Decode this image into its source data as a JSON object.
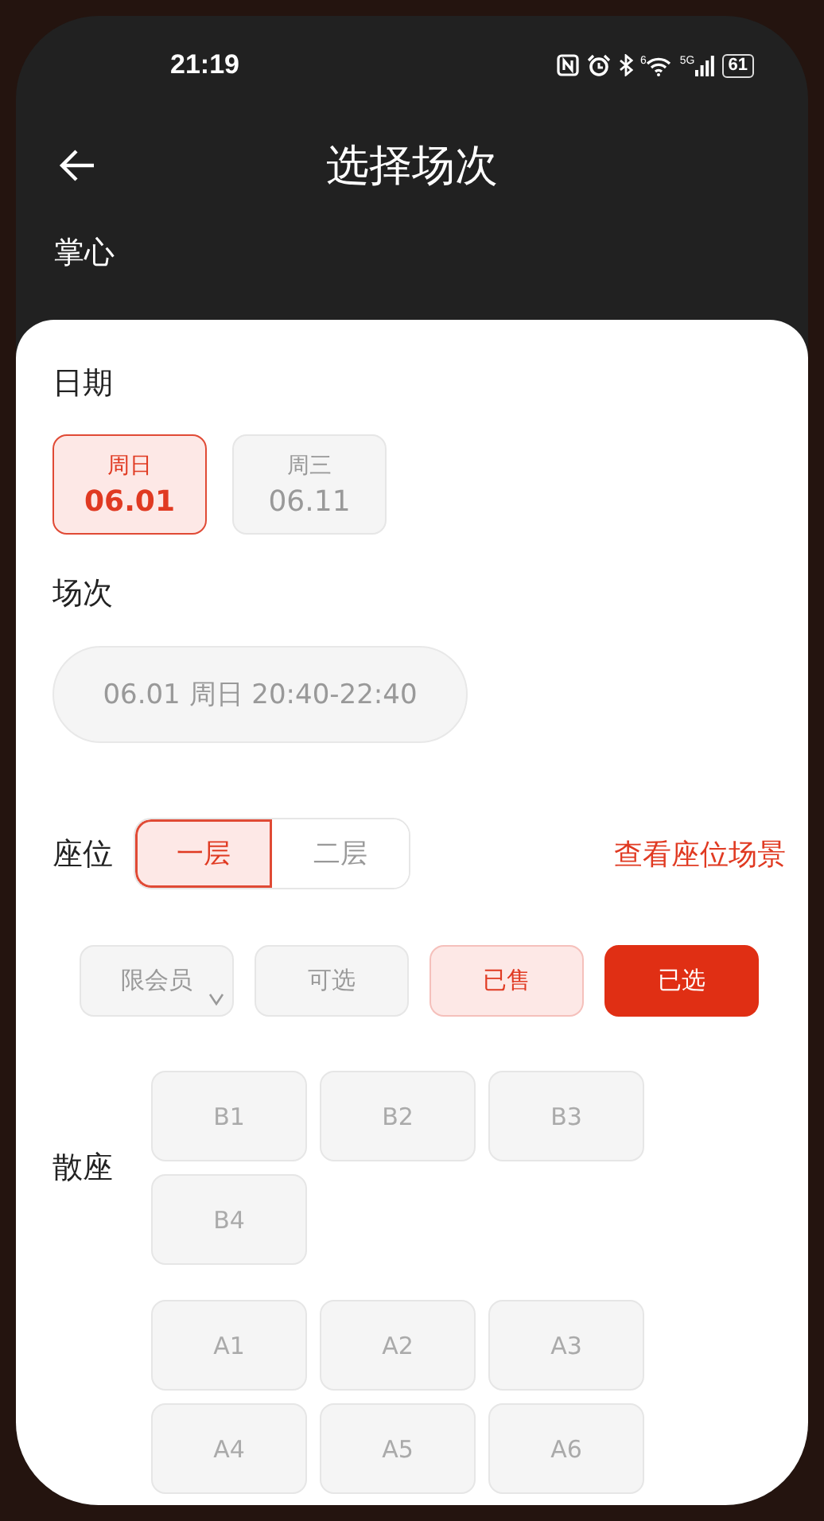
{
  "status_bar": {
    "time": "21:19",
    "wifi_badge": "6",
    "signal_badge": "5G",
    "battery": "61"
  },
  "header": {
    "title": "选择场次",
    "venue": "掌心"
  },
  "date_section": {
    "label": "日期",
    "dates": [
      {
        "weekday": "周日",
        "date": "06.01",
        "selected": true
      },
      {
        "weekday": "周三",
        "date": "06.11",
        "selected": false
      }
    ]
  },
  "session_section": {
    "label": "场次",
    "session": "06.01 周日 20:40-22:40"
  },
  "seat_section": {
    "label": "座位",
    "floors": [
      {
        "label": "一层",
        "selected": true
      },
      {
        "label": "二层",
        "selected": false
      }
    ],
    "link": "查看座位场景",
    "legend": [
      {
        "label": "限会员",
        "kind": "member"
      },
      {
        "label": "可选",
        "kind": "available"
      },
      {
        "label": "已售",
        "kind": "sold"
      },
      {
        "label": "已选",
        "kind": "selected"
      }
    ]
  },
  "seat_groups": [
    {
      "label": "散座",
      "seats": [
        {
          "label": "B1",
          "kind": "available"
        },
        {
          "label": "B2",
          "kind": "available"
        },
        {
          "label": "B3",
          "kind": "available"
        },
        {
          "label": "B4",
          "kind": "available"
        }
      ]
    },
    {
      "seats": [
        {
          "label": "A1",
          "kind": "available"
        },
        {
          "label": "A2",
          "kind": "available"
        },
        {
          "label": "A3",
          "kind": "available"
        },
        {
          "label": "A4",
          "kind": "available"
        },
        {
          "label": "A5",
          "kind": "available"
        },
        {
          "label": "A6",
          "kind": "available"
        }
      ]
    }
  ]
}
